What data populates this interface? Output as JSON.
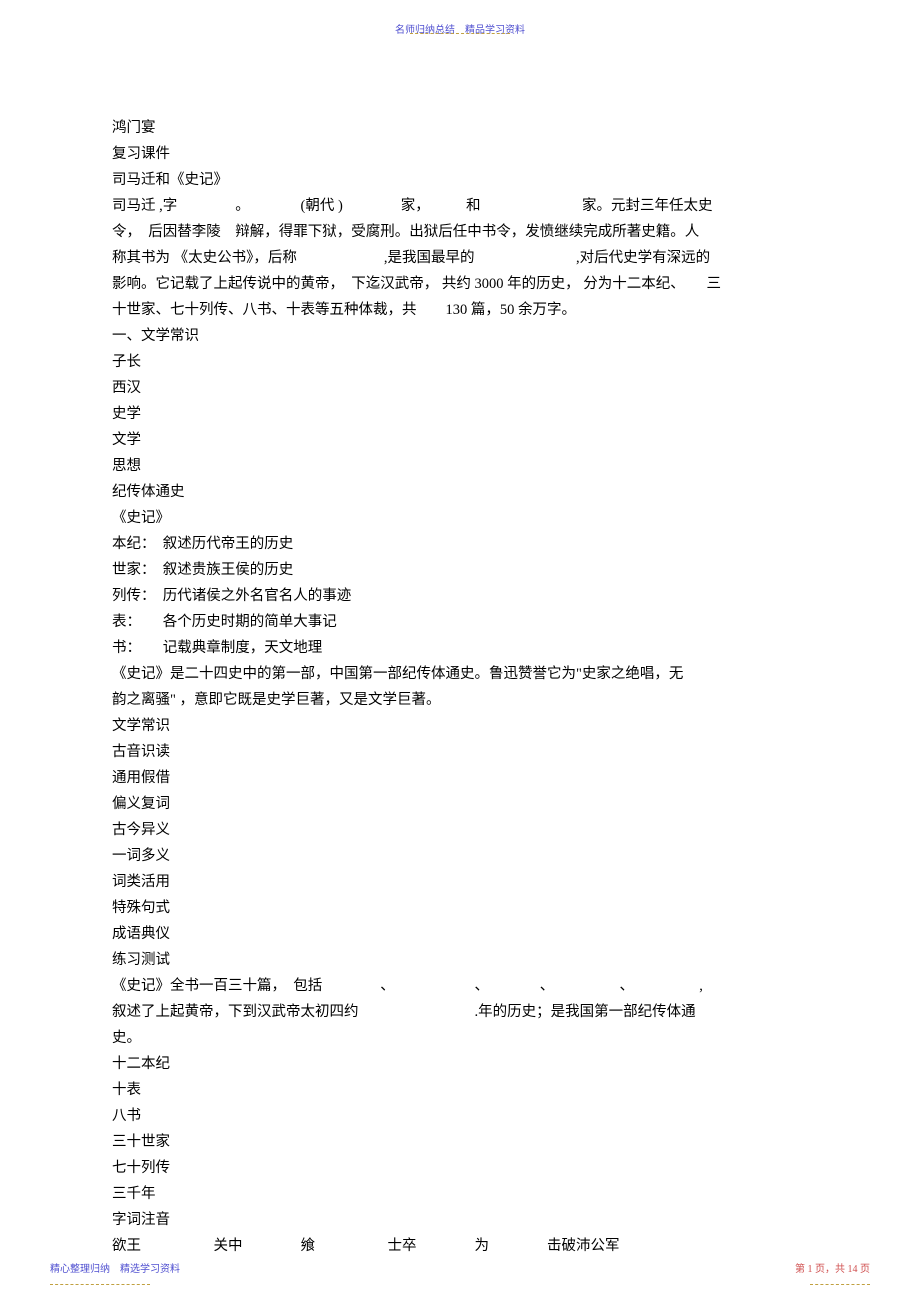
{
  "header": {
    "top_text": "名师归纳总结　精品学习资料"
  },
  "body": {
    "lines": [
      "鸿门宴",
      "复习课件",
      "司马迁和《史记》",
      "司马迁 ,字　　　　。　　　　(朝代 )　　　　家，　　　和　　　　　　　家。元封三年任太史",
      "令，　后因替李陵　辩解，得罪下狱，受腐刑。出狱后任中书令，发愤继续完成所著史籍。人",
      "称其书为 《太史公书》，后称　　　　　　,是我国最早的　　　　　　　,对后代史学有深远的",
      "影响。它记载了上起传说中的黄帝，　下迄汉武帝， 共约 3000 年的历史， 分为十二本纪、　　三",
      "十世家、七十列传、八书、十表等五种体裁，共　　130 篇，50 余万字。",
      "一、文学常识",
      "子长",
      "西汉",
      "史学",
      "文学",
      "思想",
      "纪传体通史",
      "《史记》",
      "本纪：　叙述历代帝王的历史",
      "世家：　叙述贵族王侯的历史",
      "列传：　历代诸侯之外名官名人的事迹",
      "  表：　　各个历史时期的简单大事记",
      "  书：　　记载典章制度，天文地理",
      "《史记》是二十四史中的第一部，中国第一部纪传体通史。鲁迅赞誉它为\"史家之绝唱，无",
      "韵之离骚\" ，意即它既是史学巨著，又是文学巨著。",
      "文学常识",
      "古音识读",
      "通用假借",
      "偏义复词",
      "古今异义",
      "一词多义",
      "词类活用",
      "特殊句式",
      "成语典仪",
      "练习测试",
      "《史记》全书一百三十篇，　包括　　　　、　　　　　　、　　　　、　　　　　、　　　　　,",
      "叙述了上起黄帝，下到汉武帝太初四约　　　　　　　　.年的历史；是我国第一部纪传体通",
      "史。",
      "十二本纪",
      "十表",
      "八书",
      "三十世家",
      "七十列传",
      "三千年",
      "字词注音",
      "欲王　　　　　关中　　　　飨　　　　　士卒　　　　为　　　　击破沛公军"
    ]
  },
  "footer": {
    "left": "精心整理归纳　精选学习资料",
    "right": "第 1 页，共 14 页"
  }
}
